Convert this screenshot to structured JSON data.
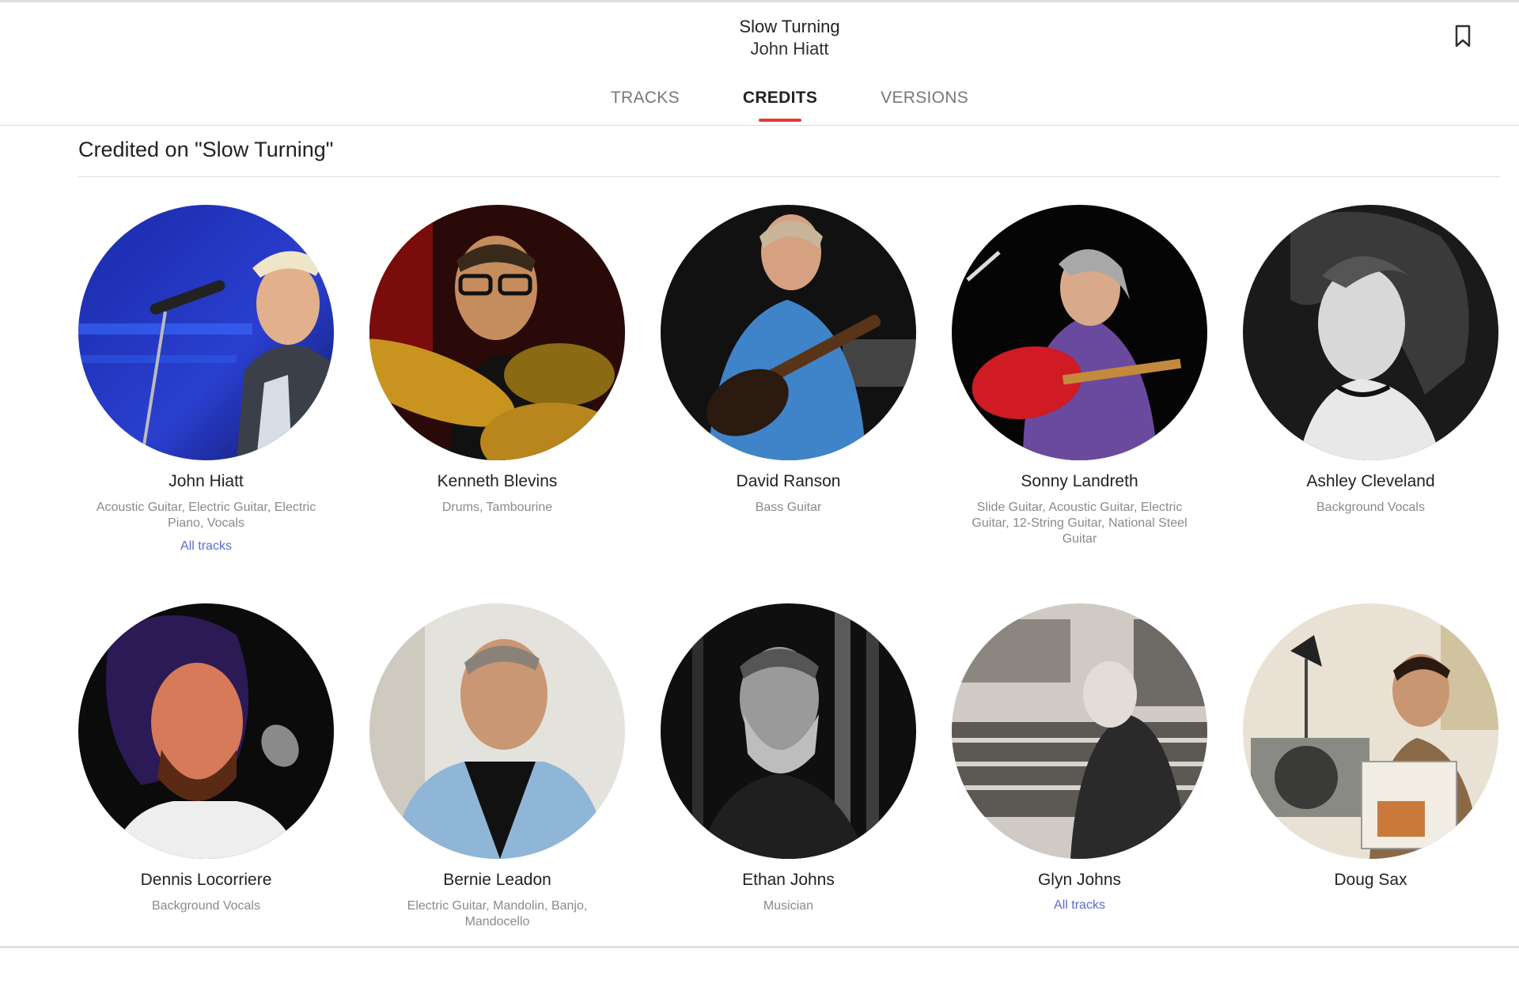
{
  "header": {
    "album_title": "Slow Turning",
    "artist": "John Hiatt",
    "bookmark_icon": "bookmark-icon"
  },
  "tabs": [
    {
      "label": "TRACKS",
      "active": false
    },
    {
      "label": "CREDITS",
      "active": true
    },
    {
      "label": "VERSIONS",
      "active": false
    }
  ],
  "section": {
    "title": "Credited on \"Slow Turning\""
  },
  "accent_color": "#e53935",
  "link_color": "#5a6bd1",
  "credits": [
    {
      "name": "John Hiatt",
      "roles": "Acoustic Guitar, Electric Guitar, Electric Piano, Vocals",
      "link": "All tracks",
      "photo": "singer-at-microphone"
    },
    {
      "name": "Kenneth Blevins",
      "roles": "Drums, Tambourine",
      "photo": "drummer-with-cymbals"
    },
    {
      "name": "David Ranson",
      "roles": "Bass Guitar",
      "photo": "bassist-blue-shirt"
    },
    {
      "name": "Sonny Landreth",
      "roles": "Slide Guitar, Acoustic Guitar, Electric Guitar, 12-String Guitar, National Steel Guitar",
      "photo": "guitarist-red-guitar"
    },
    {
      "name": "Ashley Cleveland",
      "roles": "Background Vocals",
      "photo": "bw-portrait-woman"
    },
    {
      "name": "Dennis Locorriere",
      "roles": "Background Vocals",
      "photo": "singer-red-light"
    },
    {
      "name": "Bernie Leadon",
      "roles": "Electric Guitar, Mandolin, Banjo, Mandocello",
      "photo": "man-denim-jacket"
    },
    {
      "name": "Ethan Johns",
      "roles": "Musician",
      "photo": "bw-bearded-man"
    },
    {
      "name": "Glyn Johns",
      "roles": "",
      "link": "All tracks",
      "photo": "mixing-console-sepia"
    },
    {
      "name": "Doug Sax",
      "roles": "",
      "photo": "man-with-lathe-record"
    }
  ]
}
